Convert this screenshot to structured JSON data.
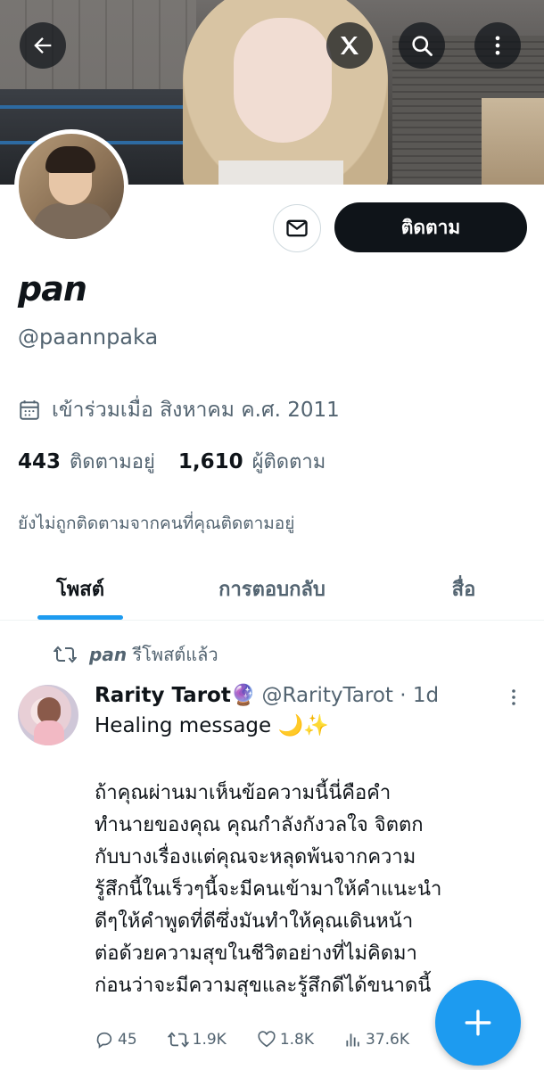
{
  "profile": {
    "name": "pan",
    "handle": "@paannpaka",
    "joined": "เข้าร่วมเมื่อ สิงหาคม ค.ศ. 2011",
    "following_count": "443",
    "following_label": "ติดตามอยู่",
    "followers_count": "1,610",
    "followers_label": "ผู้ติดตาม",
    "not_followed_note": "ยังไม่ถูกติดตามจากคนที่คุณติดตามอยู่",
    "follow_label": "ติดตาม"
  },
  "header_icons": {
    "back": "back-arrow-icon",
    "grok": "grok-icon",
    "search": "search-icon",
    "more": "more-vertical-icon"
  },
  "tabs": [
    {
      "label": "โพสต์",
      "active": true
    },
    {
      "label": "การตอบกลับ",
      "active": false
    },
    {
      "label": "สื่อ",
      "active": false
    }
  ],
  "repost": {
    "user": "pan",
    "text": "รีโพสต์แล้ว"
  },
  "tweet": {
    "name": "Rarity Tarot",
    "emoji": "🔮",
    "handle_time": "@RarityTarot · 1d",
    "line1": "Healing message 🌙✨",
    "body": "ถ้าคุณผ่านมาเห็นข้อความนี้นี่คือคำ\nทำนายของคุณ คุณกำลังกังวลใจ จิตตก\nกับบางเรื่องแต่คุณจะหลุดพ้นจากความ\nรู้สึกนี้ในเร็วๆนี้จะมีคนเข้ามาให้คำแนะนำ\nดีๆให้คำพูดที่ดีซึ่งมันทำให้คุณเดินหน้า\nต่อด้วยความสุขในชีวิตอย่างที่ไม่คิดมา\nก่อนว่าจะมีความสุขและรู้สึกดีได้ขนาดนี้",
    "replies": "45",
    "reposts": "1.9K",
    "likes": "1.8K",
    "views": "37.6K"
  },
  "colors": {
    "accent": "#1d9bf0",
    "text": "#0f1419",
    "muted": "#536471"
  }
}
